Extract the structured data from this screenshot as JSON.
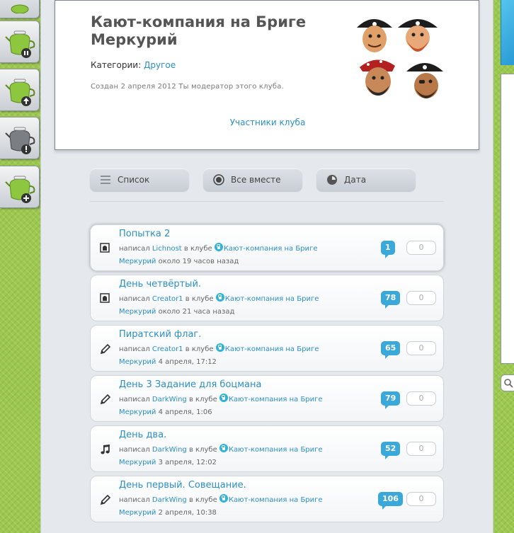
{
  "dock": {
    "buttons": [
      {
        "name": "dock-button-top"
      },
      {
        "name": "dock-button-pause"
      },
      {
        "name": "dock-button-upload"
      },
      {
        "name": "dock-button-alert"
      },
      {
        "name": "dock-button-add"
      }
    ]
  },
  "club": {
    "title": "Кают-компания на Бриге Меркурий",
    "categories_label": "Категории:",
    "category": "Другое",
    "created": "Создан 2 апреля 2012 Ты модератор этого клуба.",
    "members_link": "Участники клуба"
  },
  "filters": {
    "list": "Список",
    "all_together": "Все вместе",
    "date": "Дата"
  },
  "posts": [
    {
      "title": "Попытка 2",
      "wrote": "написал",
      "author": "Lichnost",
      "in_club": "в клубе",
      "club_start": "Кают-компания на Бриге",
      "club_end": "Меркурий",
      "time": "около 19 часов назад",
      "comments": "1",
      "rating": "0",
      "icon": "lock-post-icon"
    },
    {
      "title": "День четвёртый.",
      "wrote": "написал",
      "author": "Creator1",
      "in_club": "в клубе",
      "club_start": "Кают-компания на Бриге",
      "club_end": "Меркурий",
      "time": "около 21 часа назад",
      "comments": "78",
      "rating": "0",
      "icon": "lock-post-icon"
    },
    {
      "title": "Пиратский флаг.",
      "wrote": "написал",
      "author": "Creator1",
      "in_club": "в клубе",
      "club_start": "Кают-компания на Бриге",
      "club_end": "Меркурий",
      "time": "4 апреля, 17:12",
      "comments": "65",
      "rating": "0",
      "icon": "pencil-icon"
    },
    {
      "title": "День 3 Задание для боцмана",
      "wrote": "написал",
      "author": "DarkWing",
      "in_club": "в клубе",
      "club_start": "Кают-компания на Бриге",
      "club_end": "Меркурий",
      "time": "4 апреля, 1:06",
      "comments": "79",
      "rating": "0",
      "icon": "pencil-icon"
    },
    {
      "title": "День два.",
      "wrote": "написал",
      "author": "DarkWing",
      "in_club": "в клубе",
      "club_start": "Кают-компания на Бриге",
      "club_end": "Меркурий",
      "time": "3 апреля, 12:02",
      "comments": "52",
      "rating": "0",
      "icon": "music-note-icon"
    },
    {
      "title": "День первый. Совещание.",
      "wrote": "написал",
      "author": "DarkWing",
      "in_club": "в клубе",
      "club_start": "Кают-компания на Бриге",
      "club_end": "Меркурий",
      "time": "2 апреля, 10:38",
      "comments": "106",
      "rating": "0",
      "icon": "pencil-icon"
    }
  ],
  "colors": {
    "accent": "#2b8fc7",
    "comment_badge": "#3aa8d8",
    "background": "#9cc84e"
  }
}
